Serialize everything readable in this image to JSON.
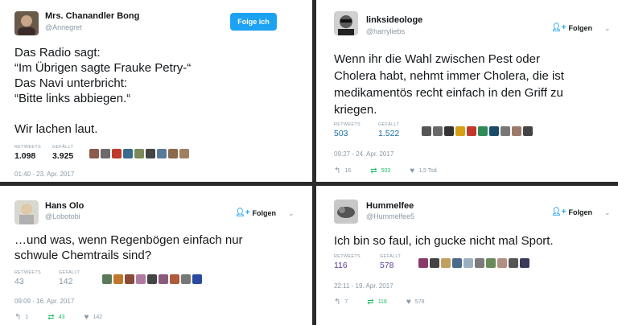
{
  "colors": {
    "accent": "#1da1f2",
    "retweet": "#17bf63",
    "muted": "#8899a6",
    "divider": "#2b2b2b"
  },
  "labels": {
    "retweets": "RETWEETS",
    "likes": "GEFÄLLT"
  },
  "tweets": [
    {
      "name": "Mrs. Chanandler Bong",
      "handle": "@Annegret",
      "follow": "Folge ich",
      "text": [
        "Das Radio sagt:",
        "“Im Übrigen sagte Frauke Petry-“",
        "Das Navi unterbricht:",
        "“Bitte links abbiegen.“",
        "",
        "Wir lachen laut."
      ],
      "retweets": "1.098",
      "likes": "3.925",
      "date": "01:40 - 23. Apr. 2017",
      "faces": [
        "#8b5a4a",
        "#6b6b6b",
        "#c0392b",
        "#3a6b8a",
        "#7a8a5a",
        "#444",
        "#5a7a9a",
        "#8a6a4a",
        "#a08060"
      ]
    },
    {
      "name": "linksideologe",
      "handle": "@harryliebs",
      "follow": "Folgen",
      "text": [
        "Wenn ihr die Wahl zwischen Pest oder",
        "Cholera habt, nehmt immer Cholera, die ist",
        "medikamentös recht einfach in den Griff zu",
        "kriegen."
      ],
      "retweets": "503",
      "likes": "1.522",
      "date": "09:27 - 24. Apr. 2017",
      "reply_count": "16",
      "rt_count": "503",
      "like_count": "1,5 Tsd.",
      "faces": [
        "#555",
        "#6a6a6a",
        "#333",
        "#d4a017",
        "#c0392b",
        "#2e8b57",
        "#1a4a6a",
        "#777",
        "#9a7a6a",
        "#444"
      ]
    },
    {
      "name": "Hans Olo",
      "handle": "@Lobotobi",
      "follow": "Folgen",
      "text": [
        "…und was, wenn Regenbögen einfach nur",
        "schwule Chemtrails sind?"
      ],
      "retweets": "43",
      "likes": "142",
      "date": "09:09 - 16. Apr. 2017",
      "reply_count": "1",
      "rt_count": "43",
      "like_count": "142",
      "faces": [
        "#5a7a5a",
        "#c0762b",
        "#8a4a3a",
        "#b07aa0",
        "#444",
        "#8a5a7a",
        "#b05a3a",
        "#777",
        "#2a4aa0"
      ]
    },
    {
      "name": "Hummelfee",
      "handle": "@Hummelfee5",
      "follow": "Folgen",
      "text": [
        "Ich bin so faul, ich gucke nicht mal Sport."
      ],
      "retweets": "116",
      "likes": "578",
      "date": "22:11 - 19. Apr. 2017",
      "reply_count": "7",
      "rt_count": "116",
      "like_count": "578",
      "faces": [
        "#8a3a6a",
        "#444",
        "#c0a060",
        "#4a6a8a",
        "#9ab0c0",
        "#7a7a7a",
        "#6a8a5a",
        "#b09080",
        "#555",
        "#3a3a5a"
      ]
    }
  ]
}
